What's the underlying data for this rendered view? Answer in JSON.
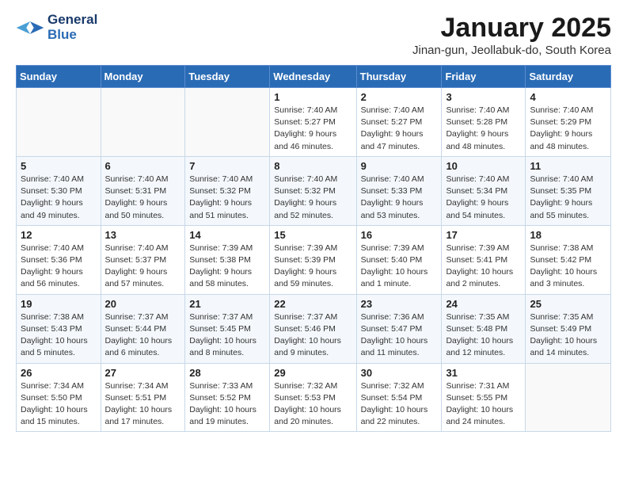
{
  "header": {
    "logo_general": "General",
    "logo_blue": "Blue",
    "month_title": "January 2025",
    "location": "Jinan-gun, Jeollabuk-do, South Korea"
  },
  "days_header": [
    "Sunday",
    "Monday",
    "Tuesday",
    "Wednesday",
    "Thursday",
    "Friday",
    "Saturday"
  ],
  "weeks": [
    [
      {
        "day": "",
        "content": ""
      },
      {
        "day": "",
        "content": ""
      },
      {
        "day": "",
        "content": ""
      },
      {
        "day": "1",
        "content": "Sunrise: 7:40 AM\nSunset: 5:27 PM\nDaylight: 9 hours and 46 minutes."
      },
      {
        "day": "2",
        "content": "Sunrise: 7:40 AM\nSunset: 5:27 PM\nDaylight: 9 hours and 47 minutes."
      },
      {
        "day": "3",
        "content": "Sunrise: 7:40 AM\nSunset: 5:28 PM\nDaylight: 9 hours and 48 minutes."
      },
      {
        "day": "4",
        "content": "Sunrise: 7:40 AM\nSunset: 5:29 PM\nDaylight: 9 hours and 48 minutes."
      }
    ],
    [
      {
        "day": "5",
        "content": "Sunrise: 7:40 AM\nSunset: 5:30 PM\nDaylight: 9 hours and 49 minutes."
      },
      {
        "day": "6",
        "content": "Sunrise: 7:40 AM\nSunset: 5:31 PM\nDaylight: 9 hours and 50 minutes."
      },
      {
        "day": "7",
        "content": "Sunrise: 7:40 AM\nSunset: 5:32 PM\nDaylight: 9 hours and 51 minutes."
      },
      {
        "day": "8",
        "content": "Sunrise: 7:40 AM\nSunset: 5:32 PM\nDaylight: 9 hours and 52 minutes."
      },
      {
        "day": "9",
        "content": "Sunrise: 7:40 AM\nSunset: 5:33 PM\nDaylight: 9 hours and 53 minutes."
      },
      {
        "day": "10",
        "content": "Sunrise: 7:40 AM\nSunset: 5:34 PM\nDaylight: 9 hours and 54 minutes."
      },
      {
        "day": "11",
        "content": "Sunrise: 7:40 AM\nSunset: 5:35 PM\nDaylight: 9 hours and 55 minutes."
      }
    ],
    [
      {
        "day": "12",
        "content": "Sunrise: 7:40 AM\nSunset: 5:36 PM\nDaylight: 9 hours and 56 minutes."
      },
      {
        "day": "13",
        "content": "Sunrise: 7:40 AM\nSunset: 5:37 PM\nDaylight: 9 hours and 57 minutes."
      },
      {
        "day": "14",
        "content": "Sunrise: 7:39 AM\nSunset: 5:38 PM\nDaylight: 9 hours and 58 minutes."
      },
      {
        "day": "15",
        "content": "Sunrise: 7:39 AM\nSunset: 5:39 PM\nDaylight: 9 hours and 59 minutes."
      },
      {
        "day": "16",
        "content": "Sunrise: 7:39 AM\nSunset: 5:40 PM\nDaylight: 10 hours and 1 minute."
      },
      {
        "day": "17",
        "content": "Sunrise: 7:39 AM\nSunset: 5:41 PM\nDaylight: 10 hours and 2 minutes."
      },
      {
        "day": "18",
        "content": "Sunrise: 7:38 AM\nSunset: 5:42 PM\nDaylight: 10 hours and 3 minutes."
      }
    ],
    [
      {
        "day": "19",
        "content": "Sunrise: 7:38 AM\nSunset: 5:43 PM\nDaylight: 10 hours and 5 minutes."
      },
      {
        "day": "20",
        "content": "Sunrise: 7:37 AM\nSunset: 5:44 PM\nDaylight: 10 hours and 6 minutes."
      },
      {
        "day": "21",
        "content": "Sunrise: 7:37 AM\nSunset: 5:45 PM\nDaylight: 10 hours and 8 minutes."
      },
      {
        "day": "22",
        "content": "Sunrise: 7:37 AM\nSunset: 5:46 PM\nDaylight: 10 hours and 9 minutes."
      },
      {
        "day": "23",
        "content": "Sunrise: 7:36 AM\nSunset: 5:47 PM\nDaylight: 10 hours and 11 minutes."
      },
      {
        "day": "24",
        "content": "Sunrise: 7:35 AM\nSunset: 5:48 PM\nDaylight: 10 hours and 12 minutes."
      },
      {
        "day": "25",
        "content": "Sunrise: 7:35 AM\nSunset: 5:49 PM\nDaylight: 10 hours and 14 minutes."
      }
    ],
    [
      {
        "day": "26",
        "content": "Sunrise: 7:34 AM\nSunset: 5:50 PM\nDaylight: 10 hours and 15 minutes."
      },
      {
        "day": "27",
        "content": "Sunrise: 7:34 AM\nSunset: 5:51 PM\nDaylight: 10 hours and 17 minutes."
      },
      {
        "day": "28",
        "content": "Sunrise: 7:33 AM\nSunset: 5:52 PM\nDaylight: 10 hours and 19 minutes."
      },
      {
        "day": "29",
        "content": "Sunrise: 7:32 AM\nSunset: 5:53 PM\nDaylight: 10 hours and 20 minutes."
      },
      {
        "day": "30",
        "content": "Sunrise: 7:32 AM\nSunset: 5:54 PM\nDaylight: 10 hours and 22 minutes."
      },
      {
        "day": "31",
        "content": "Sunrise: 7:31 AM\nSunset: 5:55 PM\nDaylight: 10 hours and 24 minutes."
      },
      {
        "day": "",
        "content": ""
      }
    ]
  ]
}
